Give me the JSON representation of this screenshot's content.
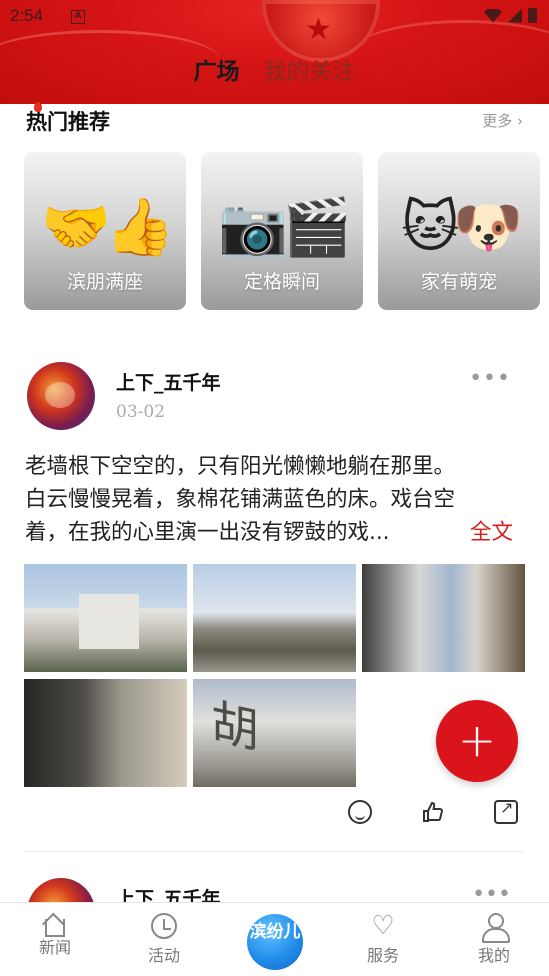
{
  "status_bar": {
    "time": "2:54",
    "app_icon": "A"
  },
  "header": {
    "tabs": [
      {
        "label": "广场",
        "active": true
      },
      {
        "label": "我的关注",
        "active": false
      }
    ]
  },
  "hot": {
    "title": "热门推荐",
    "more_label": "更多",
    "cards": [
      {
        "label": "滨朋满座",
        "emoji": "🤝👍"
      },
      {
        "label": "定格瞬间",
        "emoji": "📷🎬"
      },
      {
        "label": "家有萌宠",
        "emoji": "🐱🐶"
      }
    ]
  },
  "post": {
    "author": "上下_五千年",
    "date": "03-02",
    "text_lines": [
      "老墙根下空空的，只有阳光懒懒地躺在那里。",
      "白云慢慢晃着，象棉花铺满蓝色的床。戏台空",
      "着，在我的心里演一出没有锣鼓的戏..."
    ],
    "full_text_label": "全文",
    "photo_count": 5
  },
  "next_post": {
    "author": "上下_五千年"
  },
  "fab": {
    "label": "+"
  },
  "bottom_nav": {
    "items": [
      {
        "label": "新闻",
        "icon": "home-icon"
      },
      {
        "label": "活动",
        "icon": "clock-icon"
      },
      {
        "label": "滨纷儿",
        "icon": "app-logo"
      },
      {
        "label": "服务",
        "icon": "heart-icon"
      },
      {
        "label": "我的",
        "icon": "user-icon"
      }
    ]
  },
  "colors": {
    "brand_red": "#d9141b",
    "header_red": "#d41414",
    "accent_blue": "#1f88e8"
  }
}
